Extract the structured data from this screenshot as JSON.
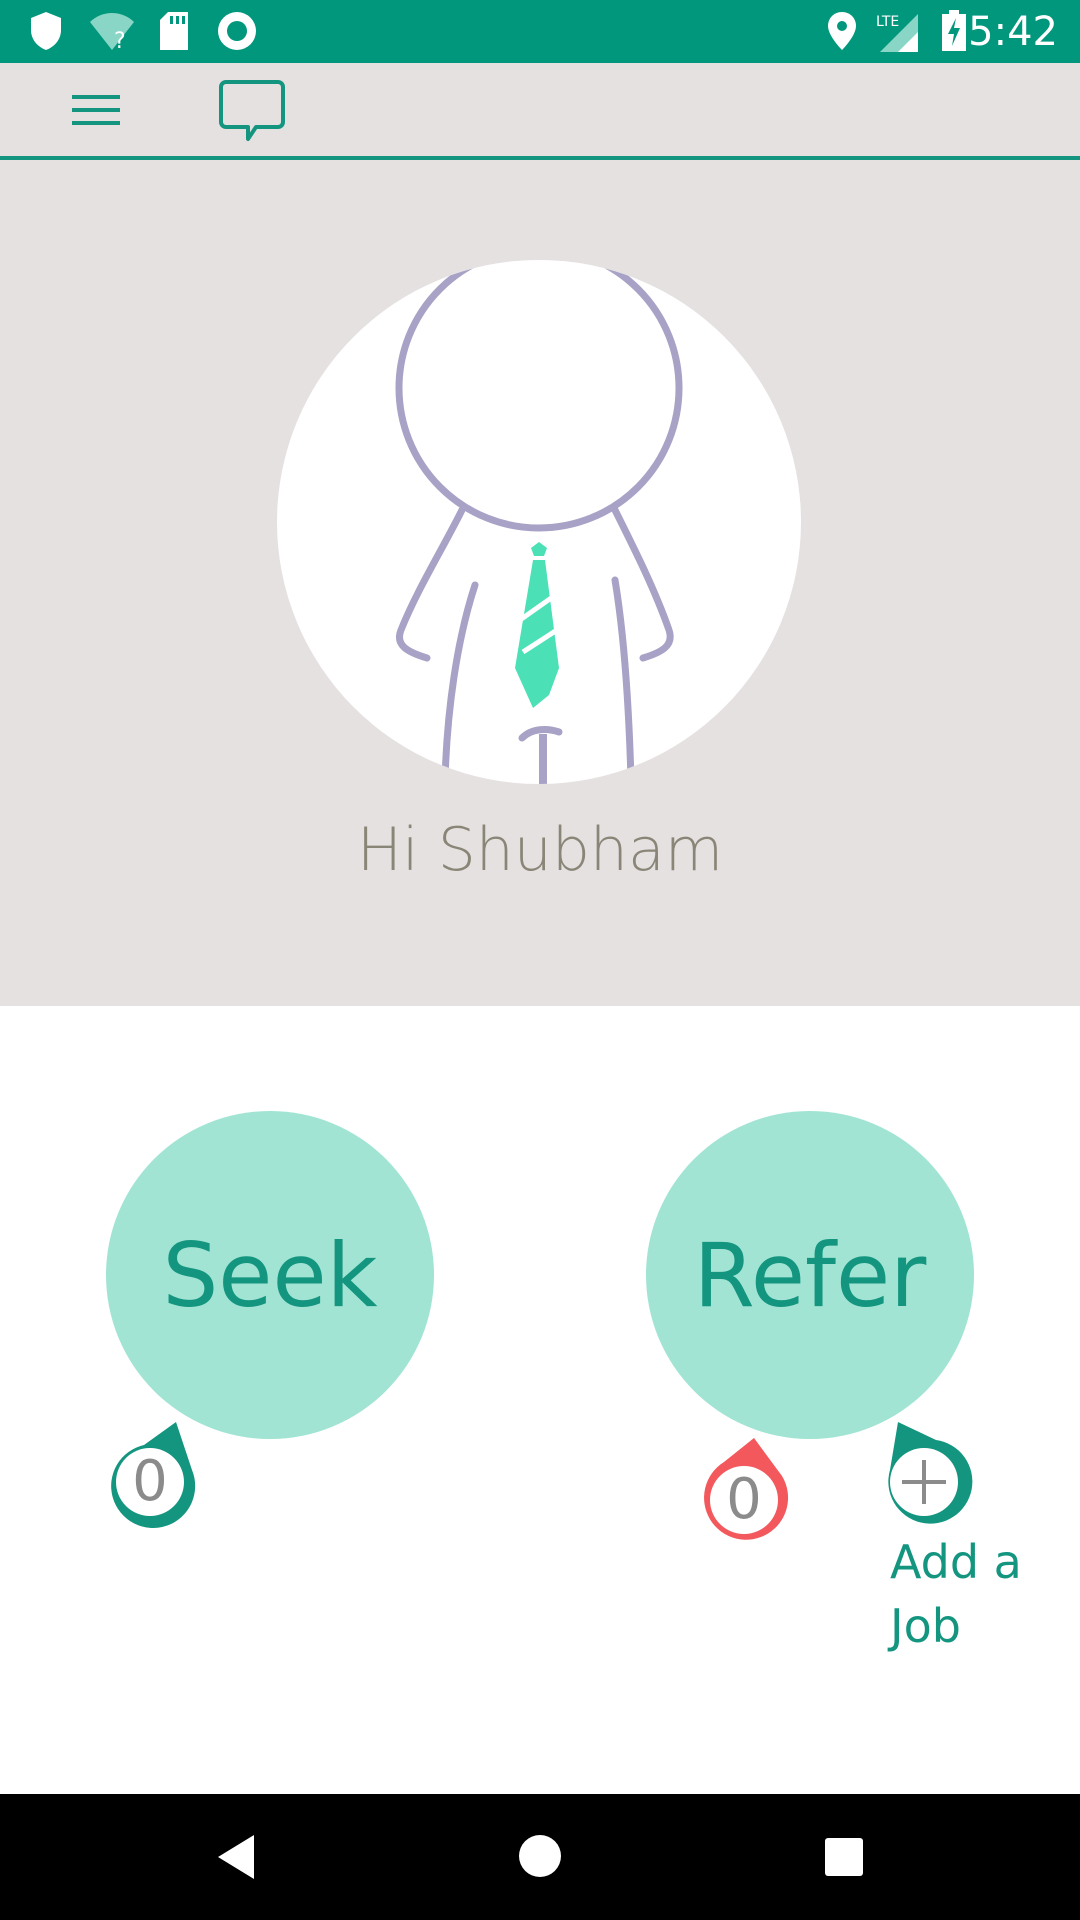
{
  "status_bar": {
    "time": "5:42",
    "icons": [
      "shield-icon",
      "wifi-question-icon",
      "sd-card-icon",
      "record-icon",
      "location-icon",
      "lte-signal-icon",
      "battery-charging-icon"
    ],
    "network_label": "LTE"
  },
  "toolbar": {
    "icons": [
      "menu-icon",
      "chat-icon"
    ]
  },
  "profile": {
    "greeting": "Hi Shubham"
  },
  "actions": {
    "seek_label": "Seek",
    "refer_label": "Refer",
    "seek_count": "0",
    "refer_count": "0",
    "add_job_line1": "Add a",
    "add_job_line2": "Job"
  },
  "colors": {
    "accent": "#13957f",
    "status_bar": "#00977c",
    "circle_fill": "#a1e4d3",
    "header_bg": "#e6e1e1",
    "alert": "#f2585c"
  }
}
